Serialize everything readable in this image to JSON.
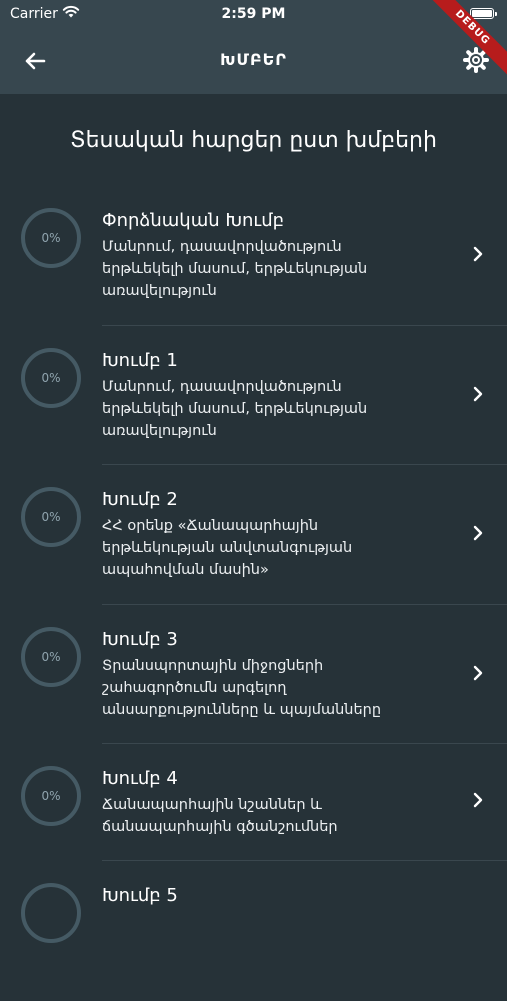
{
  "status_bar": {
    "carrier": "Carrier",
    "time": "2:59 PM"
  },
  "app_bar": {
    "title": "ԽՄԲԵՐ"
  },
  "debug_banner": "DEBUG",
  "heading": "Տեսական հարցեր ըստ խմբերի",
  "groups": [
    {
      "progress": "0%",
      "title": "Փորձնական Խումբ",
      "description": "Մանրում, դասավորվածություն երթևեկելի մասում, երթևեկության առավելություն"
    },
    {
      "progress": "0%",
      "title": "Խումբ 1",
      "description": "Մանրում, դասավորվածություն երթևեկելի մասում, երթևեկության առավելություն"
    },
    {
      "progress": "0%",
      "title": "Խումբ 2",
      "description": "ՀՀ օրենք «Ճանապարհային երթևեկության անվտանգության ապահովման մասին»"
    },
    {
      "progress": "0%",
      "title": "Խումբ 3",
      "description": "Տրանսպորտային միջոցների շահագործումն արգելող անսարքությունները և պայմանները"
    },
    {
      "progress": "0%",
      "title": "Խումբ 4",
      "description": "Ճանապարհային նշաններ և ճանապարհային գծանշումներ"
    },
    {
      "progress": "",
      "title": "Խումբ 5",
      "description": ""
    }
  ]
}
